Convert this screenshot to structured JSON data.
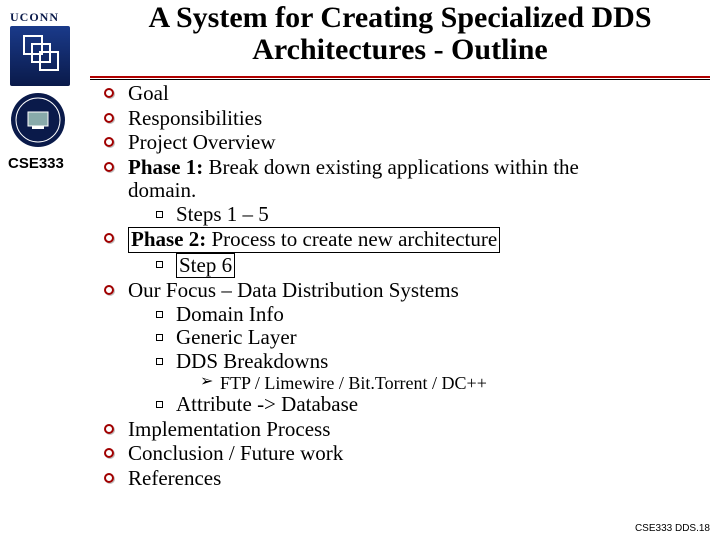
{
  "header": {
    "uconn": "UCONN",
    "course": "CSE333"
  },
  "title_line1": "A System for Creating Specialized DDS",
  "title_line2": "Architectures - Outline",
  "outline": {
    "i1": "Goal",
    "i2": "Responsibilities",
    "i3": "Project Overview",
    "i4_label": "Phase 1:",
    "i4_rest_a": " Break down existing applications within the",
    "i4_rest_b": "domain.",
    "i4_sub1": "Steps 1 – 5",
    "i5_label": "Phase 2:",
    "i5_rest": " Process to create new architecture",
    "i5_sub1": "Step 6",
    "i6": "Our Focus – Data Distribution Systems",
    "i6_sub1": "Domain Info",
    "i6_sub2": "Generic Layer",
    "i6_sub3": "DDS Breakdowns",
    "i6_sub3_a": "FTP / Limewire / Bit.Torrent / DC++",
    "i6_sub4": "Attribute -> Database",
    "i7": "Implementation Process",
    "i8": "Conclusion / Future work",
    "i9": "References"
  },
  "footer": "CSE333 DDS.18"
}
